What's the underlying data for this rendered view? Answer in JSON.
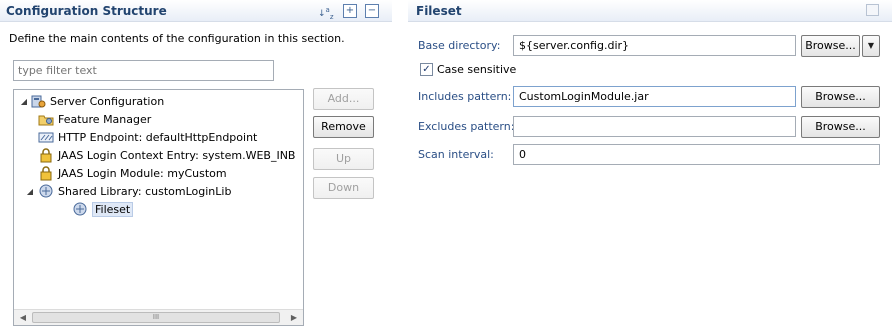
{
  "left_panel": {
    "title": "Configuration Structure",
    "description": "Define the main contents of the configuration in this section.",
    "filter_placeholder": "type filter text",
    "tree": [
      {
        "label": "Server Configuration",
        "icon": "server-config-icon",
        "expanded": true
      },
      {
        "label": "Feature Manager",
        "icon": "feature-manager-icon"
      },
      {
        "label": "HTTP Endpoint: defaultHttpEndpoint",
        "icon": "http-endpoint-icon"
      },
      {
        "label": "JAAS Login Context Entry: system.WEB_INB",
        "icon": "lock-icon"
      },
      {
        "label": "JAAS Login Module: myCustom",
        "icon": "lock-icon"
      },
      {
        "label": "Shared Library: customLoginLib",
        "icon": "shared-library-icon",
        "expanded": true
      },
      {
        "label": "Fileset",
        "icon": "fileset-icon",
        "selected": true
      }
    ],
    "buttons": {
      "add": "Add...",
      "remove": "Remove",
      "up": "Up",
      "down": "Down"
    },
    "scrollbar_thumb": "III"
  },
  "right_panel": {
    "title": "Fileset",
    "fields": {
      "base_directory_label": "Base directory:",
      "base_directory_value": "${server.config.dir}",
      "case_sensitive_label": "Case sensitive",
      "case_sensitive_checked": true,
      "includes_label": "Includes pattern:",
      "includes_value": "CustomLoginModule.jar",
      "excludes_label": "Excludes pattern:",
      "excludes_value": "",
      "scan_label": "Scan interval:",
      "scan_value": "0"
    },
    "browse_label": "Browse..."
  },
  "colors": {
    "title_text": "#22446f",
    "field_label": "#2a4e85",
    "selection_bg": "#dfe8f6"
  }
}
